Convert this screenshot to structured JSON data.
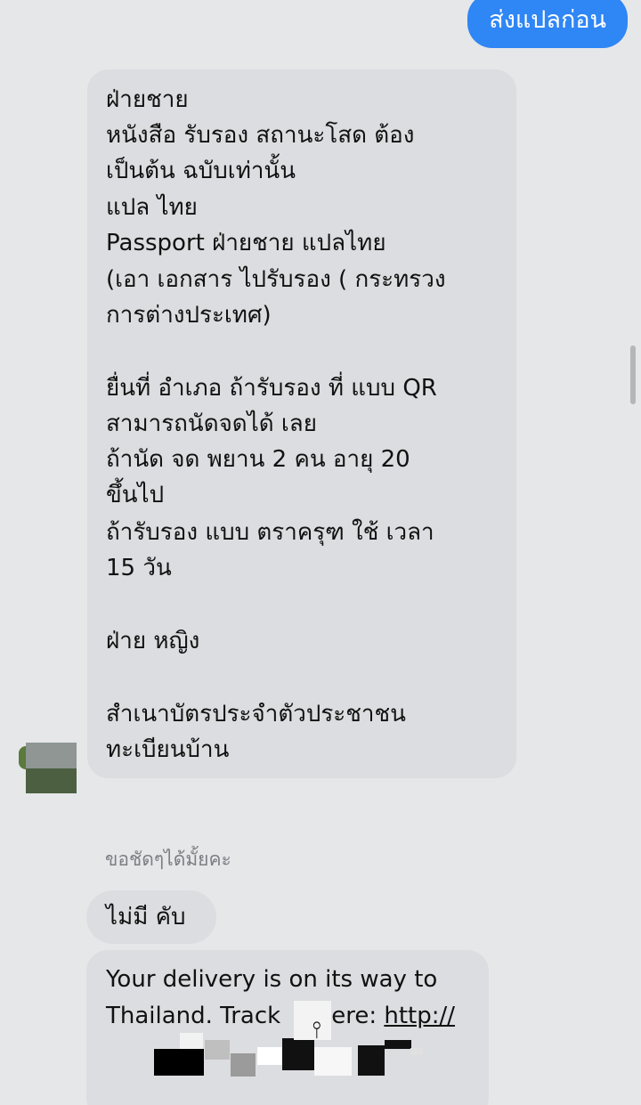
{
  "outgoing": {
    "text": "ส่งแปลก่อน"
  },
  "incoming_message": {
    "lines": [
      "ฝ่ายชาย",
      "หนังสือ รับรอง สถานะโสด ต้อง",
      "เป็นต้น ฉบับเท่านั้น",
      "แปล ไทย",
      "Passport ฝ่ายชาย แปลไทย",
      "(เอา เอกสาร ไปรับรอง ( กระทรวง",
      "การต่างประเทศ)",
      "ยื่นที่ อำเภอ  ถ้ารับรอง ที่ แบบ QR",
      "สามารถนัดจดได้ เลย",
      "ถ้านัด จด พยาน 2 คน อายุ 20",
      "ขึ้นไป",
      "ถ้ารับรอง แบบ ตราครุฑ ใช้ เวลา",
      "15 วัน",
      "ฝ่าย หญิง",
      "สำเนาบัตรประจำตัวประชาชน",
      "ทะเบียนบ้าน"
    ]
  },
  "reply_label": "ขอชัดๆได้มั้ยคะ",
  "reply_message": {
    "text": "ไม่มี คับ"
  },
  "delivery_message": {
    "line1": "Your delivery is on its way to",
    "line2_prefix": "Thailand. Track",
    "line2_middle": "ere: ",
    "link_text": "http://"
  },
  "colors": {
    "background": "#e6e7e9",
    "incoming_bubble": "#dcdde0",
    "outgoing_bubble": "#2f86f5",
    "outgoing_text": "#ffffff",
    "muted_text": "#7c7e83"
  },
  "icons": {
    "avatar": "contact-avatar",
    "cursor": "text-cursor-icon"
  }
}
